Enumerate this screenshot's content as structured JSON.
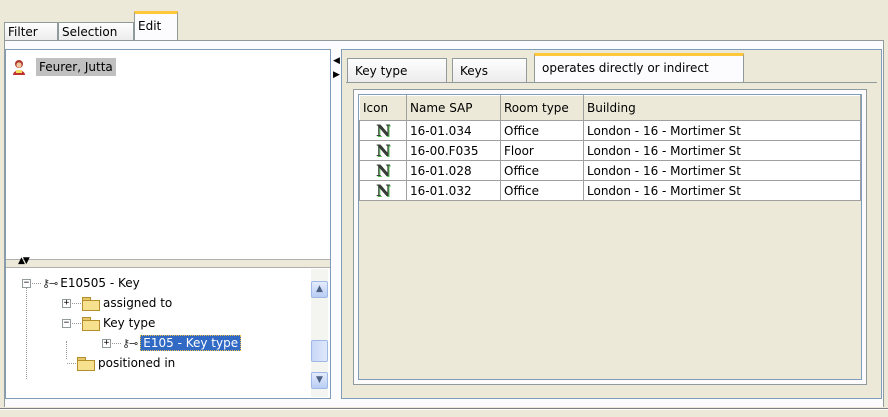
{
  "top_tabs": [
    {
      "label": "Filter",
      "active": false
    },
    {
      "label": "Selection",
      "active": false
    },
    {
      "label": "Edit",
      "active": true
    }
  ],
  "left_pane": {
    "person": {
      "icon": "person-icon",
      "name": "Feurer, Jutta"
    },
    "tree": [
      {
        "label": "E10505 - Key",
        "icon": "key-icon",
        "expander": "−",
        "level": 0
      },
      {
        "label": "assigned to",
        "icon": "folder-icon",
        "expander": "+",
        "level": 1
      },
      {
        "label": "Key type",
        "icon": "folder-open-icon",
        "expander": "−",
        "level": 1
      },
      {
        "label": "E105 - Key type",
        "icon": "key-icon",
        "expander": "+",
        "level": 2,
        "selected": true
      },
      {
        "label": "positioned in",
        "icon": "folder-icon",
        "expander": "",
        "level": 1
      }
    ]
  },
  "right_pane": {
    "tabs": [
      {
        "label": "Key type",
        "active": false
      },
      {
        "label": "Keys",
        "active": false
      },
      {
        "label": "operates directly or indirect",
        "active": true
      }
    ],
    "table": {
      "columns": [
        "Icon",
        "Name SAP",
        "Room type",
        "Building"
      ],
      "rows": [
        {
          "icon": "room-icon",
          "name": "16-01.034",
          "room_type": "Office",
          "building": "London - 16 - Mortimer St"
        },
        {
          "icon": "room-icon",
          "name": "16-00.F035",
          "room_type": "Floor",
          "building": "London - 16 - Mortimer St"
        },
        {
          "icon": "room-icon",
          "name": "16-01.028",
          "room_type": "Office",
          "building": "London - 16 - Mortimer St"
        },
        {
          "icon": "room-icon",
          "name": "16-01.032",
          "room_type": "Office",
          "building": "London - 16 - Mortimer St"
        }
      ]
    }
  },
  "colors": {
    "accent_tab": "#ffc83c",
    "selection": "#316ac5",
    "window_bg": "#ece9d8"
  }
}
